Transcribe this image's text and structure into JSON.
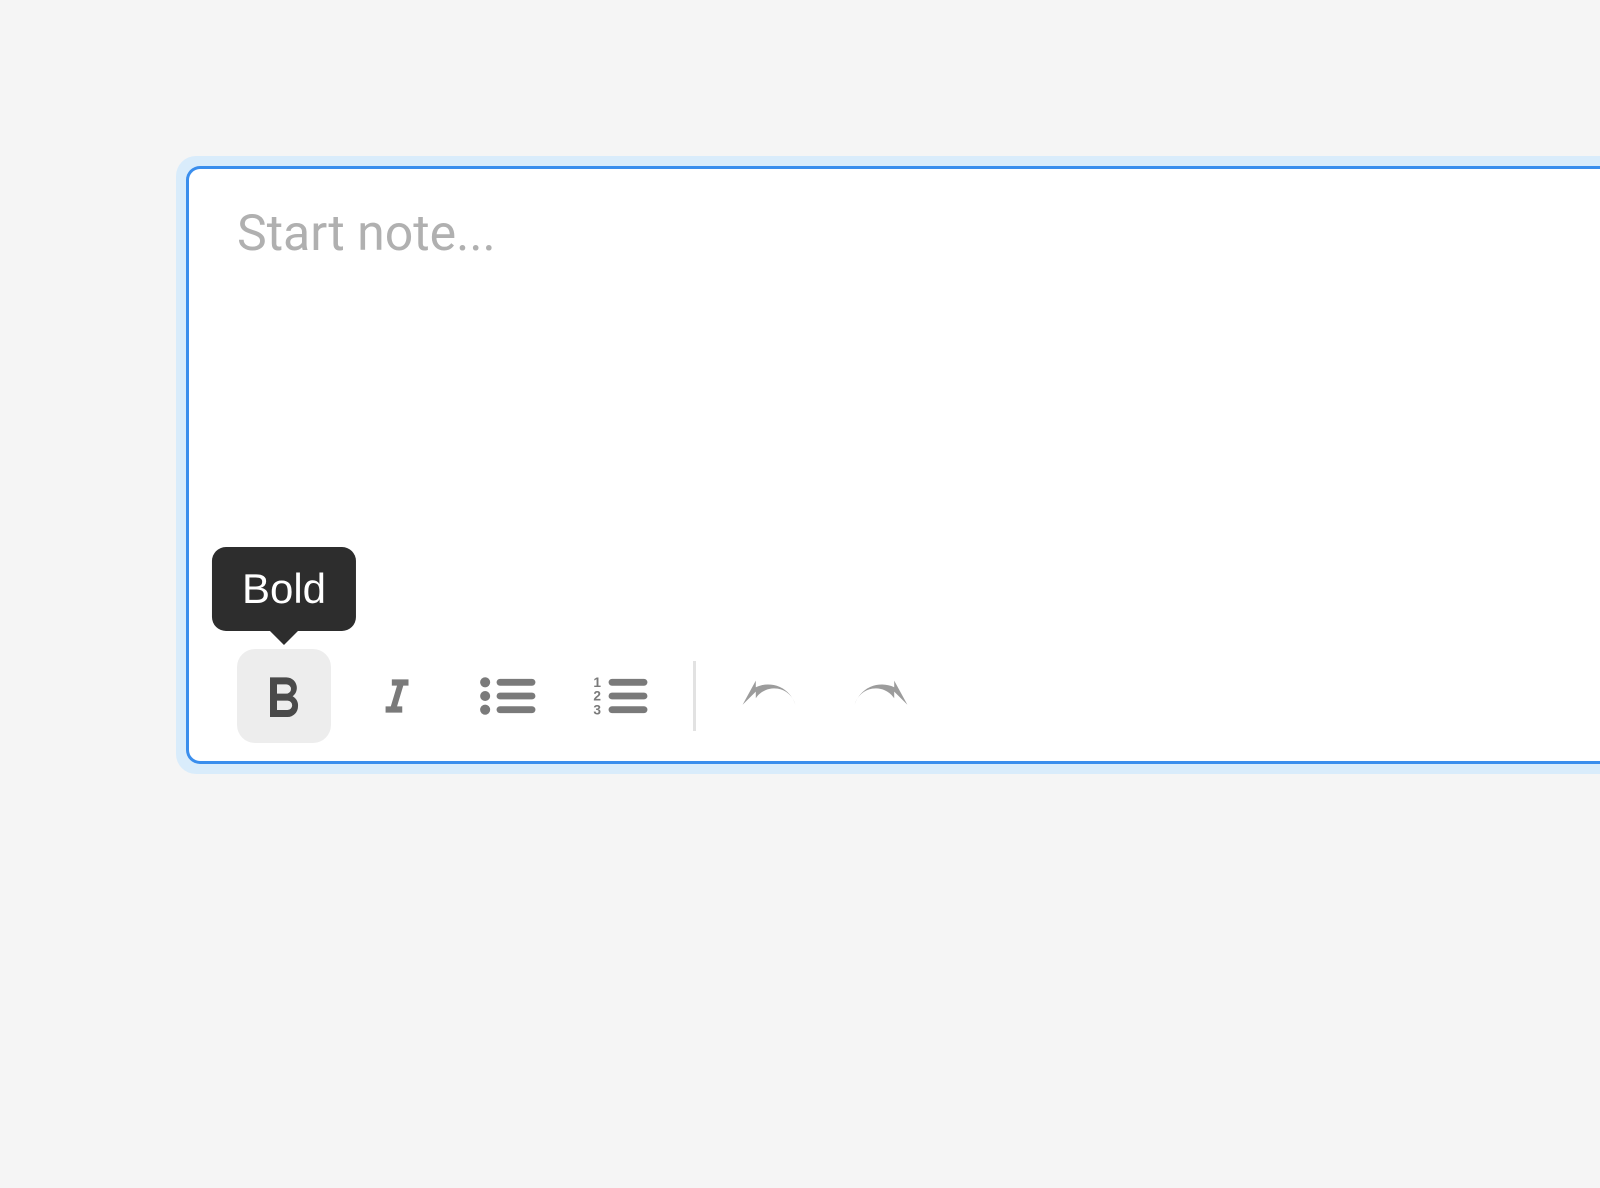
{
  "editor": {
    "placeholder": "Start note..."
  },
  "toolbar": {
    "bold": {
      "tooltip": "Bold"
    }
  }
}
